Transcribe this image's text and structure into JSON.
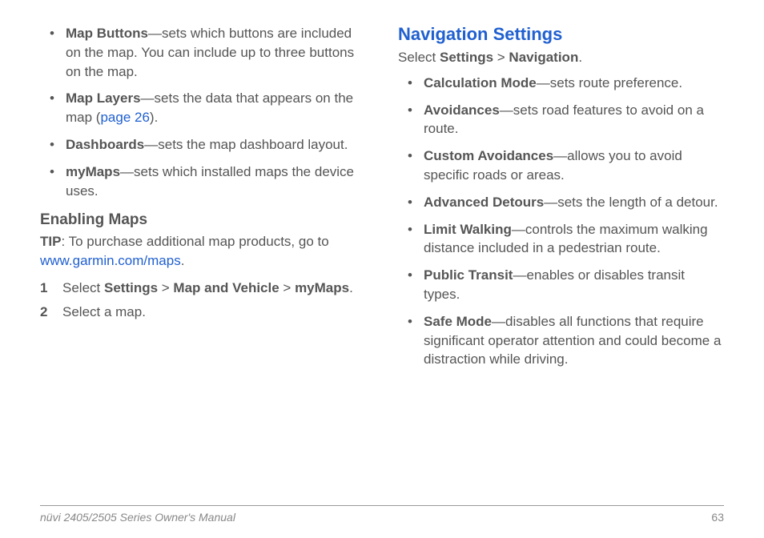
{
  "left": {
    "bullets": [
      {
        "term": "Map Buttons",
        "desc": "—sets which buttons are included on the map. You can include up to three buttons on the map."
      },
      {
        "term": "Map Layers",
        "desc_pre": "—sets the data that appears on the map (",
        "page_ref": "page 26",
        "desc_post": ")."
      },
      {
        "term": "Dashboards",
        "desc": "—sets the map dashboard layout."
      },
      {
        "term": "myMaps",
        "desc": "—sets which installed maps the device uses."
      }
    ],
    "subheading": "Enabling Maps",
    "tip_label": "TIP",
    "tip_text_pre": ": To purchase additional map products, go to ",
    "tip_link": "www.garmin.com/maps",
    "tip_text_post": ".",
    "steps": [
      {
        "num": "1",
        "pre": "Select ",
        "b1": "Settings",
        "sep1": " > ",
        "b2": "Map and Vehicle",
        "sep2": " > ",
        "b3": "myMaps",
        "post": "."
      },
      {
        "num": "2",
        "plain": "Select a map."
      }
    ]
  },
  "right": {
    "heading": "Navigation Settings",
    "instruction_pre": "Select ",
    "instruction_b1": "Settings",
    "instruction_sep": " > ",
    "instruction_b2": "Navigation",
    "instruction_post": ".",
    "bullets": [
      {
        "term": "Calculation Mode",
        "desc": "—sets route preference."
      },
      {
        "term": "Avoidances",
        "desc": "—sets road features to avoid on a route."
      },
      {
        "term": "Custom Avoidances",
        "desc": "—allows you to avoid specific roads or areas."
      },
      {
        "term": "Advanced Detours",
        "desc": "—sets the length of a detour."
      },
      {
        "term": "Limit Walking",
        "desc": "—controls the maximum walking distance included in a pedestrian route."
      },
      {
        "term": "Public Transit",
        "desc": "—enables or disables transit types."
      },
      {
        "term": "Safe Mode",
        "desc": "—disables all functions that require significant operator attention and could become a distraction while driving."
      }
    ]
  },
  "footer": {
    "manual_title": "nüvi 2405/2505 Series Owner's Manual",
    "page_number": "63"
  }
}
